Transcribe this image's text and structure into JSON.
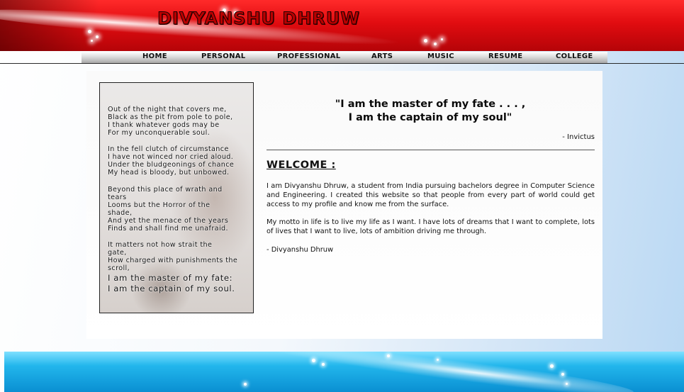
{
  "header": {
    "site_title": "DIVYANSHU DHRUW",
    "accent_color": "#e10c10"
  },
  "nav": {
    "items": [
      {
        "label": "HOME"
      },
      {
        "label": "PERSONAL"
      },
      {
        "label": "PROFESSIONAL"
      },
      {
        "label": "ARTS"
      },
      {
        "label": "MUSIC"
      },
      {
        "label": "RESUME"
      },
      {
        "label": "COLLEGE"
      }
    ]
  },
  "poem": {
    "lines": [
      "Out of the night that covers me,",
      "Black as the pit from pole to pole,",
      "I thank whatever gods may be",
      "For my unconquerable soul.",
      "In the fell clutch of circumstance",
      "I have not winced nor cried aloud.",
      "Under the bludgeonings of chance",
      "My head is bloody, but unbowed.",
      "Beyond this place of wrath and",
      "tears",
      "Looms but the Horror of the",
      "shade,",
      "And yet the menace of the years",
      "Finds and shall find me unafraid.",
      "It matters not how strait the",
      "gate,",
      "How charged with punishments the",
      "scroll,",
      "I am the master of my fate:",
      "I am the captain of my soul."
    ]
  },
  "main": {
    "quote_line1": "\"I am the master of my fate . . . ,",
    "quote_line2": "I am the captain of my soul\"",
    "attribution": "- Invictus",
    "welcome_heading": "WELCOME :",
    "intro": "I am Divyanshu Dhruw, a student from India pursuing bachelors degree in Computer Science and Engineering. I created this website so that people from every part of world could get access to my profile and know me from the surface.",
    "motto": "My motto in life is to live my life as I want. I have lots of dreams that I want to complete, lots of lives that I want to live, lots of ambition driving me through.",
    "signature": "- Divyanshu Dhruw"
  },
  "footer": {
    "accent_color": "#0a8fd2"
  }
}
